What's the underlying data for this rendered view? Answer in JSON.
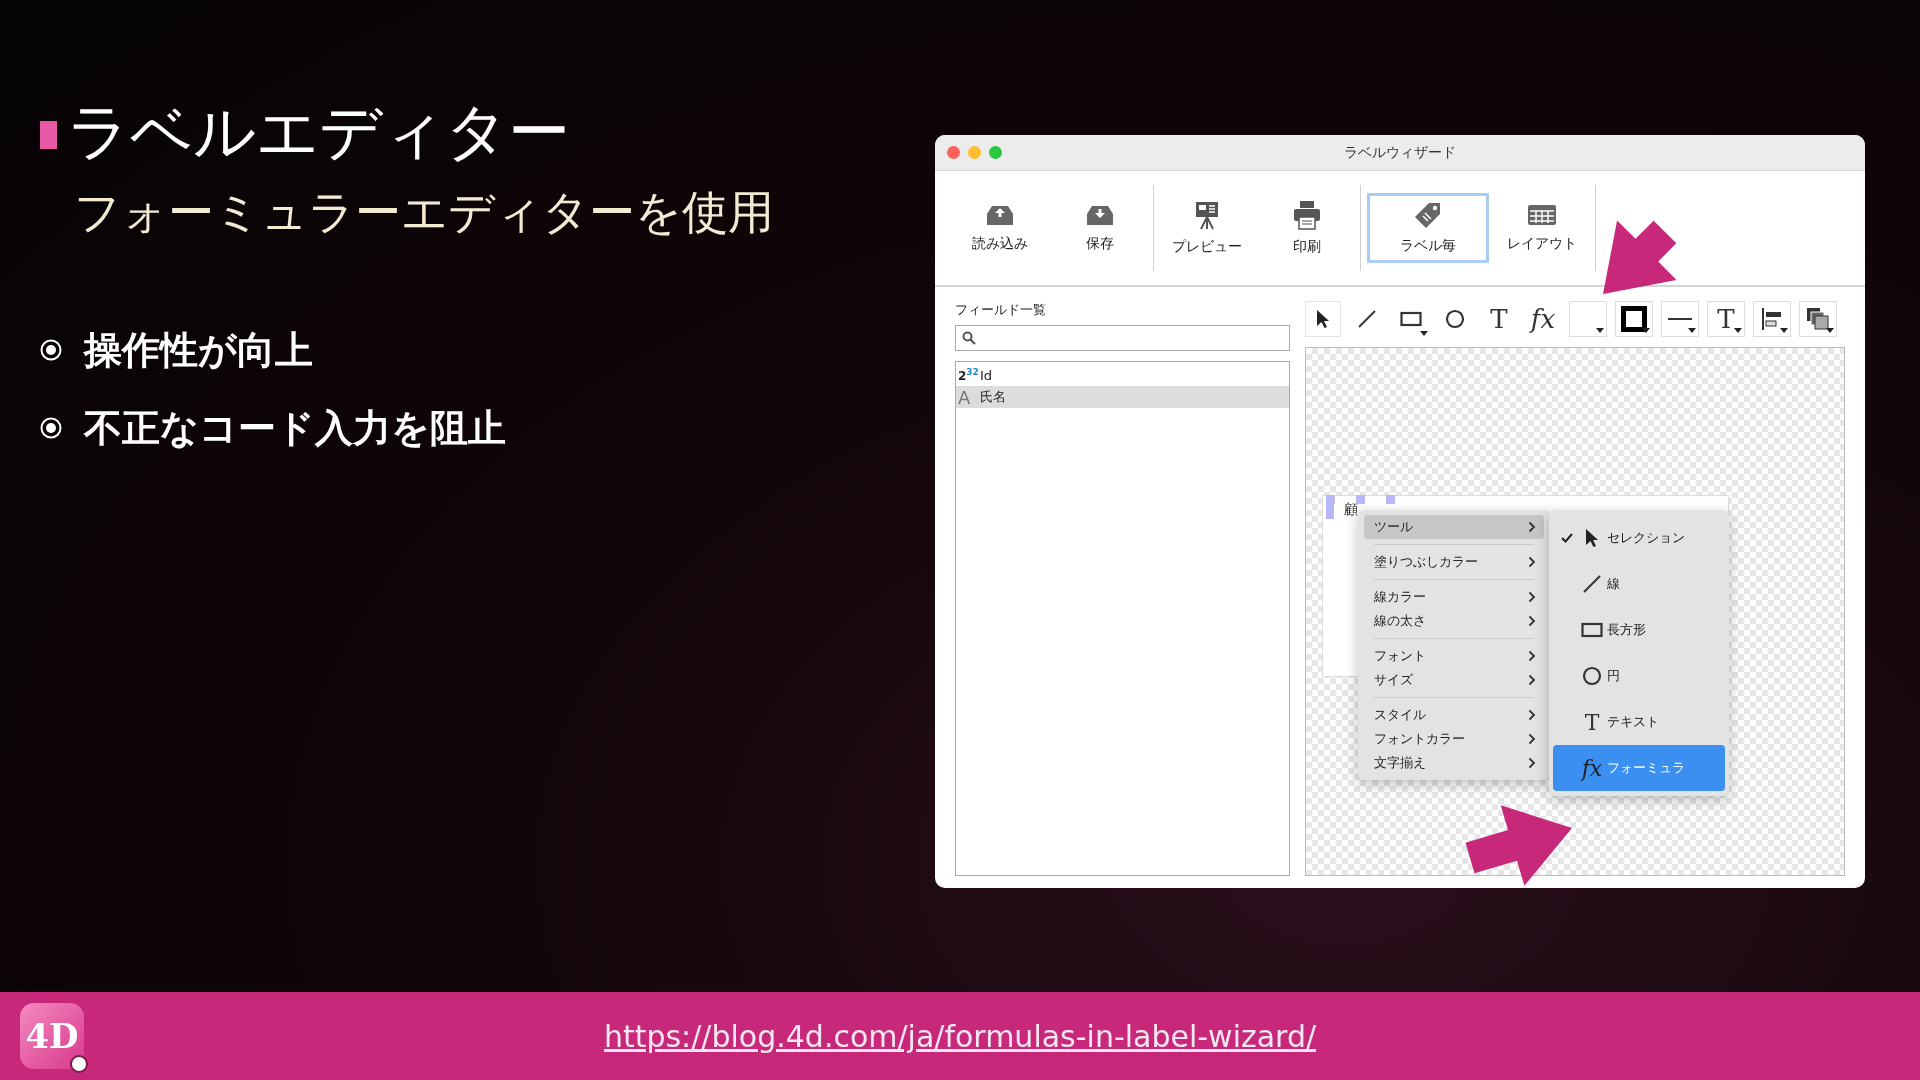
{
  "slide": {
    "title": "ラベルエディター",
    "subtitle": "フォーミュラーエディターを使用",
    "bullets": [
      "操作性が向上",
      "不正なコード入力を阻止"
    ]
  },
  "window": {
    "title": "ラベルウィザード",
    "toolbar_groups": [
      [
        {
          "label": "読み込み",
          "kind": "import",
          "selected": false
        },
        {
          "label": "保存",
          "kind": "save",
          "selected": false
        }
      ],
      [
        {
          "label": "プレビュー",
          "kind": "preview",
          "selected": false
        },
        {
          "label": "印刷",
          "kind": "print",
          "selected": false
        }
      ],
      [
        {
          "label": "ラベル毎",
          "kind": "label",
          "selected": true
        },
        {
          "label": "レイアウト",
          "kind": "layout",
          "selected": false
        }
      ]
    ],
    "field_list": {
      "title": "フィールド一覧",
      "items": [
        {
          "badge": "2$^{32}$",
          "label": "Id",
          "kind": "number",
          "selected": false
        },
        {
          "badge": "A",
          "label": "氏名",
          "kind": "text",
          "selected": true
        }
      ]
    },
    "tools": [
      {
        "kind": "pointer",
        "selected": true
      },
      {
        "kind": "line",
        "selected": false
      },
      {
        "kind": "rect",
        "selected": false
      },
      {
        "kind": "circle",
        "selected": false
      },
      {
        "kind": "text",
        "glyph": "T",
        "selected": false
      },
      {
        "kind": "formula",
        "glyph": "fx",
        "selected": false
      },
      {
        "kind": "fill"
      },
      {
        "kind": "stroke"
      },
      {
        "kind": "line-style"
      },
      {
        "kind": "text-style",
        "glyph": "T"
      },
      {
        "kind": "align"
      },
      {
        "kind": "arrange"
      }
    ],
    "canvas": {
      "label_text": "顧",
      "menu": [
        [
          {
            "label": "ツール",
            "selected": true
          }
        ],
        [
          {
            "label": "塗りつぶしカラー",
            "selected": false
          }
        ],
        [
          {
            "label": "線カラー",
            "selected": false
          },
          {
            "label": "線の太さ",
            "selected": false
          }
        ],
        [
          {
            "label": "フォント",
            "selected": false
          },
          {
            "label": "サイズ",
            "selected": false
          }
        ],
        [
          {
            "label": "スタイル",
            "selected": false
          },
          {
            "label": "フォントカラー",
            "selected": false
          },
          {
            "label": "文字揃え",
            "selected": false
          }
        ]
      ],
      "submenu": [
        {
          "label": "セレクション",
          "kind": "pointer",
          "checked": true,
          "selected": false
        },
        {
          "label": "線",
          "kind": "line",
          "checked": false,
          "selected": false
        },
        {
          "label": "長方形",
          "kind": "rect",
          "checked": false,
          "selected": false
        },
        {
          "label": "円",
          "kind": "circle",
          "checked": false,
          "selected": false
        },
        {
          "label": "テキスト",
          "kind": "text",
          "glyph": "T",
          "checked": false,
          "selected": false
        },
        {
          "label": "フォーミュラ",
          "kind": "formula",
          "glyph": "fx",
          "checked": false,
          "selected": true
        }
      ]
    }
  },
  "footer": {
    "logo": "4D",
    "url": "https://blog.4d.com/ja/formulas-in-label-wizard/"
  }
}
